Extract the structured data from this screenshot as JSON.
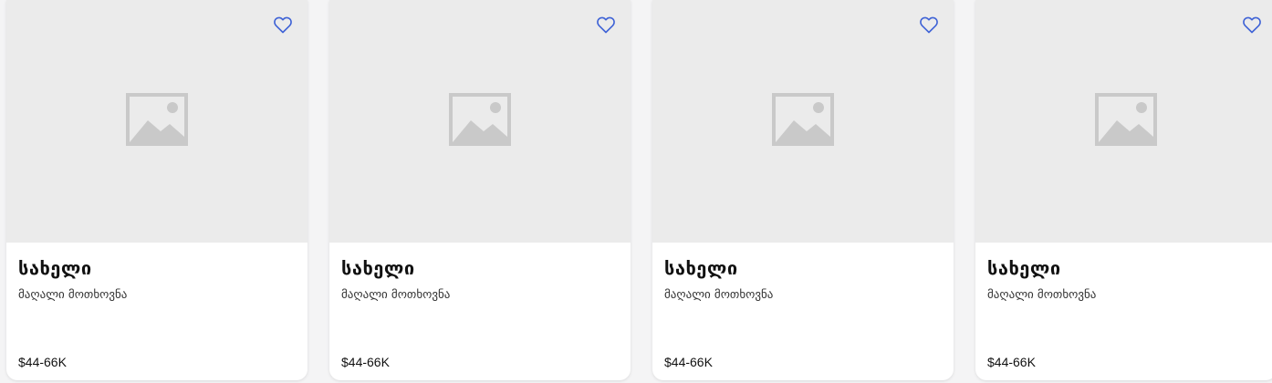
{
  "colors": {
    "heart_outline": "#3f63d6",
    "image_placeholder_bg": "#ebebeb",
    "placeholder_icon": "#c9c9c9"
  },
  "cards": [
    {
      "title": "სახელი",
      "subtitle": "მაღალი მოთხოვნა",
      "price": "$44-66K",
      "favorite_icon": "heart-outline-icon",
      "image_icon": "image-placeholder-icon"
    },
    {
      "title": "სახელი",
      "subtitle": "მაღალი მოთხოვნა",
      "price": "$44-66K",
      "favorite_icon": "heart-outline-icon",
      "image_icon": "image-placeholder-icon"
    },
    {
      "title": "სახელი",
      "subtitle": "მაღალი მოთხოვნა",
      "price": "$44-66K",
      "favorite_icon": "heart-outline-icon",
      "image_icon": "image-placeholder-icon"
    },
    {
      "title": "სახელი",
      "subtitle": "მაღალი მოთხოვნა",
      "price": "$44-66K",
      "favorite_icon": "heart-outline-icon",
      "image_icon": "image-placeholder-icon"
    }
  ]
}
